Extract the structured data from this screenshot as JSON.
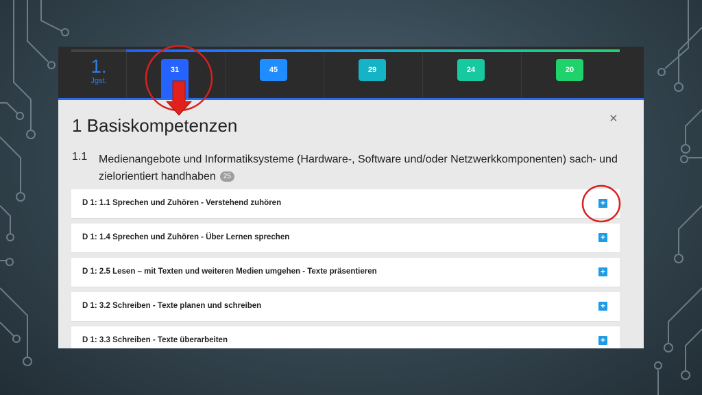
{
  "header": {
    "grade_number": "1.",
    "grade_label": "Jgst.",
    "columns": [
      {
        "count": "31",
        "color": "#2563ff"
      },
      {
        "count": "45",
        "color": "#1f8cff"
      },
      {
        "count": "29",
        "color": "#14b3c6"
      },
      {
        "count": "24",
        "color": "#16c99f"
      },
      {
        "count": "20",
        "color": "#1fd26b"
      }
    ]
  },
  "panel": {
    "title": "1 Basiskompetenzen",
    "close_icon": "×",
    "section_number": "1.1",
    "section_text": "Medienangebote und Informatiksysteme (Hardware-, Software und/oder Netzwerkkomponenten) sach- und zielorientiert handhaben",
    "section_count": "25",
    "items": [
      {
        "label": "D 1: 1.1 Sprechen und Zuhören - Verstehend zuhören"
      },
      {
        "label": "D 1: 1.4 Sprechen und Zuhören - Über Lernen sprechen"
      },
      {
        "label": "D 1: 2.5 Lesen – mit Texten und weiteren Medien umgehen - Texte präsentieren"
      },
      {
        "label": "D 1: 3.2 Schreiben - Texte planen und schreiben"
      },
      {
        "label": "D 1: 3.3 Schreiben - Texte überarbeiten"
      }
    ],
    "expand_icon": "+"
  },
  "colors": {
    "annotation_red": "#d9201c",
    "expand_blue": "#1f9ae6"
  }
}
